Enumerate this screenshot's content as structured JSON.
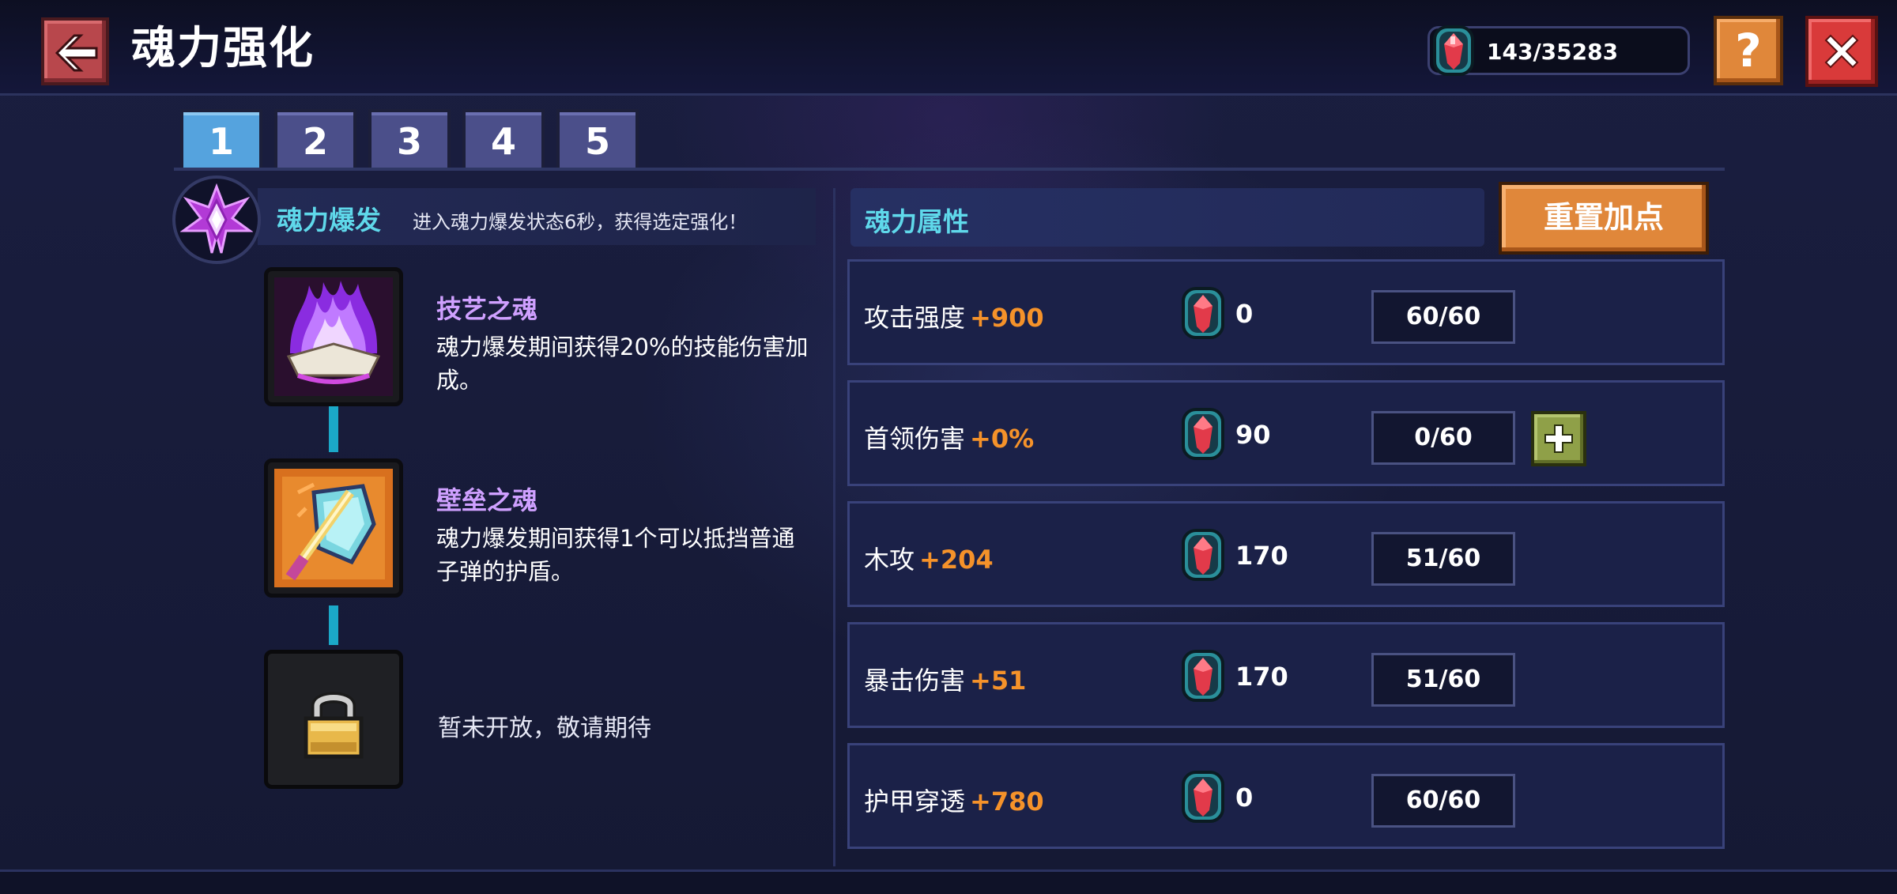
{
  "header": {
    "title": "魂力强化",
    "currency_amount": "143/35283",
    "help_label": "?"
  },
  "tabs": [
    {
      "label": "1",
      "active": true
    },
    {
      "label": "2",
      "active": false
    },
    {
      "label": "3",
      "active": false
    },
    {
      "label": "4",
      "active": false
    },
    {
      "label": "5",
      "active": false
    }
  ],
  "skill": {
    "name": "魂力爆发",
    "description": "进入魂力爆发状态6秒，获得选定强化！"
  },
  "souls": [
    {
      "name": "技艺之魂",
      "description": "魂力爆发期间获得20%的技能伤害加成。",
      "icon": "purple-flame-icon"
    },
    {
      "name": "壁垒之魂",
      "description": "魂力爆发期间获得1个可以抵挡普通子弹的护盾。",
      "icon": "shield-sword-icon"
    },
    {
      "name": "",
      "description": "暂未开放，敬请期待",
      "icon": "lock-icon"
    }
  ],
  "attributes": {
    "header": "魂力属性",
    "reset_label": "重置加点",
    "rows": [
      {
        "name": "攻击强度",
        "bonus": "+900",
        "cost": "0",
        "level": "60/60",
        "can_add": false
      },
      {
        "name": "首领伤害",
        "bonus": "+0%",
        "cost": "90",
        "level": "0/60",
        "can_add": true
      },
      {
        "name": "木攻",
        "bonus": "+204",
        "cost": "170",
        "level": "51/60",
        "can_add": false
      },
      {
        "name": "暴击伤害",
        "bonus": "+51",
        "cost": "170",
        "level": "51/60",
        "can_add": false
      },
      {
        "name": "护甲穿透",
        "bonus": "+780",
        "cost": "0",
        "level": "60/60",
        "can_add": false
      }
    ]
  },
  "colors": {
    "accent_cyan": "#5fd8ea",
    "bonus_orange": "#f5922a",
    "soul_name_purple": "#cfa0ff",
    "tab_active": "#55a3de",
    "tab_inactive": "#4b4f8a",
    "button_orange": "#e0873a",
    "close_red": "#d93a3a",
    "add_green": "#8fa048"
  }
}
